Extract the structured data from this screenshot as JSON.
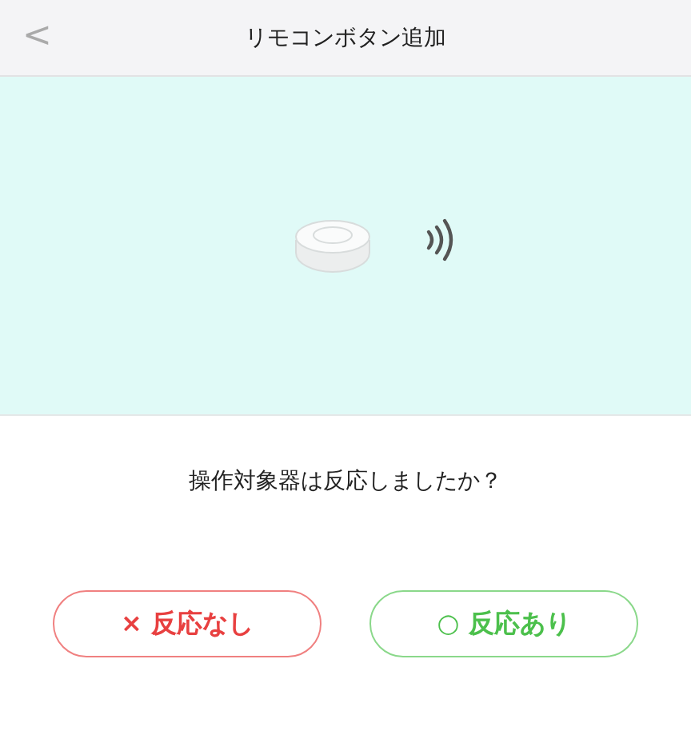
{
  "header": {
    "back": "<",
    "title": "リモコンボタン追加"
  },
  "illustration": {
    "kind": "device"
  },
  "question": "操作対象器は反応しましたか？",
  "buttons": [
    {
      "label": "× 反応なし",
      "kind": "negative"
    },
    {
      "label": "○ 反応あり",
      "kind": "positive"
    }
  ]
}
